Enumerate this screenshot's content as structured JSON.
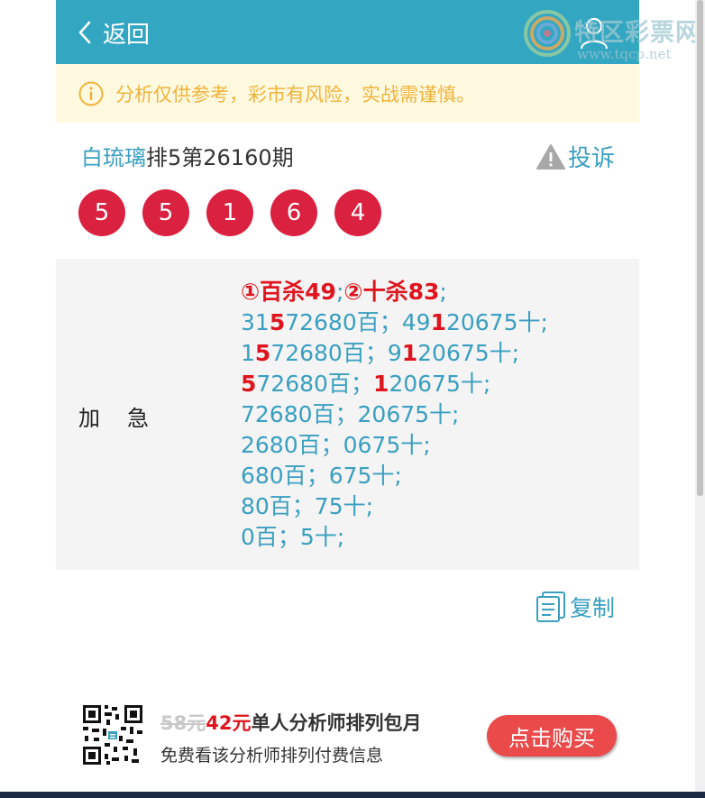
{
  "header": {
    "back_label": "返回"
  },
  "watermark": {
    "title": "特区彩票网",
    "url": "www.tqcp.net"
  },
  "notice": {
    "text": "分析仅供参考，彩市有风险，实战需谨慎。"
  },
  "lottery": {
    "analyst_name": "白琉璃",
    "issue_text": "排5第26160期",
    "complain_label": "投诉",
    "balls": [
      "5",
      "5",
      "1",
      "6",
      "4"
    ]
  },
  "analysis": {
    "tag": "加急",
    "head": {
      "part1": "①百杀49",
      "sep": ";",
      "part2": "②十杀83",
      "end": ";"
    },
    "lines": [
      [
        "31",
        "5",
        "72680百；49",
        "1",
        "20675十;"
      ],
      [
        "1",
        "5",
        "72680百；9",
        "1",
        "20675十;"
      ],
      [
        "",
        "5",
        "72680百；",
        "1",
        "20675十;"
      ],
      [
        "72680百；20675十;"
      ],
      [
        "2680百；0675十;"
      ],
      [
        "680百；675十;"
      ],
      [
        "80百；75十;"
      ],
      [
        "0百；5十;"
      ]
    ]
  },
  "copy_label": "复制",
  "promo": {
    "old_price": "58元",
    "new_price": "42元",
    "title": "单人分析师排列包月",
    "subtitle": "免费看该分析师排列付费信息",
    "buy_label": "点击购买"
  },
  "colors": {
    "header_bg": "#33a7c2",
    "accent_text": "#3a9fc0",
    "ball_red": "#db2140",
    "highlight_red": "#e0141e",
    "notice_bg": "#fff9e0",
    "notice_text": "#f0b33a",
    "buy_button": "#ea4a4a"
  },
  "icons": [
    "back-chevron-icon",
    "user-icon",
    "info-icon",
    "warning-icon",
    "copy-document-icon",
    "qr-code-icon"
  ]
}
